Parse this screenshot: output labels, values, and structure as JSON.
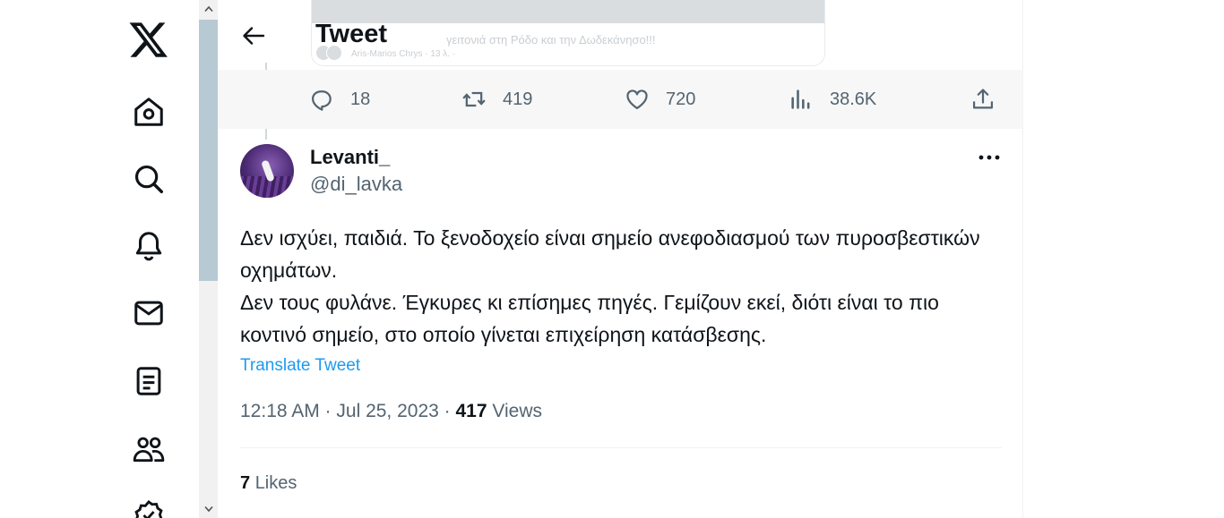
{
  "header": {
    "title": "Tweet"
  },
  "embed": {
    "caption": "γειτονιά στη Ρόδο και την Δωδεκάνησο!!!",
    "meta": "Aris-Marios Chrys · 13 λ. ·"
  },
  "actions": {
    "replies": "18",
    "retweets": "419",
    "likes": "720",
    "views": "38.6K"
  },
  "tweet": {
    "display_name": "Levanti_",
    "handle": "@di_lavka",
    "text_lines": [
      "Δεν ισχύει, παιδιά. Το ξενοδοχείο είναι σημείο ανεφοδιασμού των πυροσβεστικών οχημάτων.",
      "Δεν τους φυλάνε. Έγκυρες κι επίσημες πηγές. Γεμίζουν εκεί, διότι είναι το πιο κοντινό σημείο, στο οποίο γίνεται επιχείρηση κατάσβεσης."
    ],
    "translate_label": "Translate Tweet",
    "timestamp": "12:18 AM · Jul 25, 2023 ·",
    "views_count": "417",
    "views_label": "Views",
    "likes_count": "7",
    "likes_label": "Likes"
  },
  "nav": {
    "icons": [
      "x-logo-icon",
      "home-icon",
      "search-icon",
      "notifications-icon",
      "messages-icon",
      "lists-icon",
      "communities-icon",
      "verified-icon"
    ]
  },
  "colors": {
    "accent": "#1d9bf0",
    "text": "#0f1419",
    "muted": "#536471",
    "scroll_thumb": "#b7c9d3",
    "action_bar_bg": "#f7f7f7"
  }
}
